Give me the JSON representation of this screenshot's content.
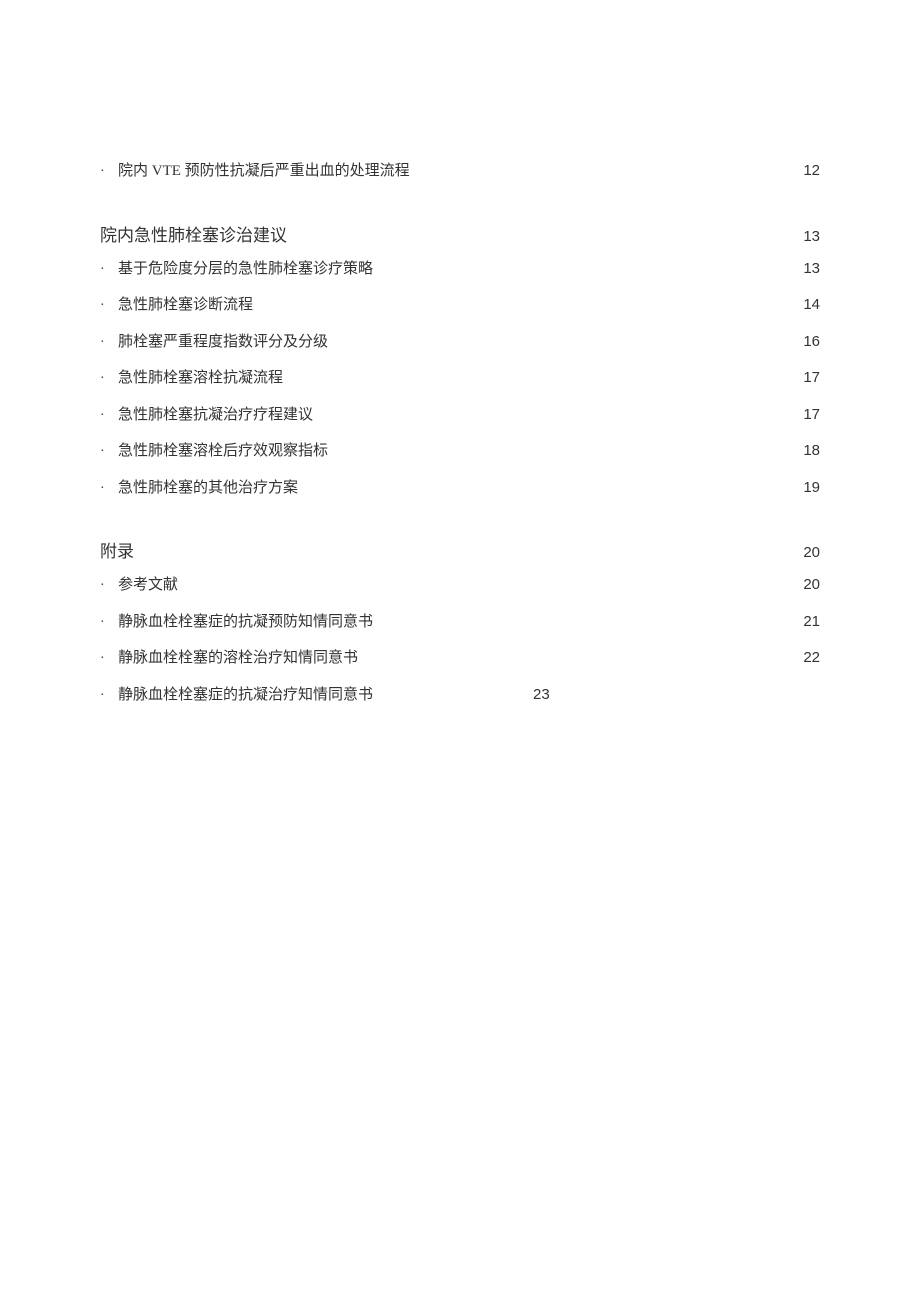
{
  "sections": [
    {
      "heading": null,
      "items": [
        {
          "title": "院内 VTE 预防性抗凝后严重出血的处理流程",
          "page": "12",
          "inline": false
        }
      ]
    },
    {
      "heading": {
        "title": "院内急性肺栓塞诊治建议",
        "page": "13"
      },
      "items": [
        {
          "title": "基于危险度分层的急性肺栓塞诊疗策略",
          "page": "13",
          "inline": false
        },
        {
          "title": "急性肺栓塞诊断流程",
          "page": "14",
          "inline": false
        },
        {
          "title": "肺栓塞严重程度指数评分及分级",
          "page": "16",
          "inline": false
        },
        {
          "title": "急性肺栓塞溶栓抗凝流程",
          "page": "17",
          "inline": false
        },
        {
          "title": "急性肺栓塞抗凝治疗疗程建议",
          "page": "17",
          "inline": false
        },
        {
          "title": "急性肺栓塞溶栓后疗效观察指标",
          "page": "18",
          "inline": false
        },
        {
          "title": "急性肺栓塞的其他治疗方案",
          "page": "19",
          "inline": false
        }
      ]
    },
    {
      "heading": {
        "title": "附录",
        "page": "20"
      },
      "items": [
        {
          "title": "参考文献",
          "page": "20",
          "inline": false
        },
        {
          "title": "静脉血栓栓塞症的抗凝预防知情同意书",
          "page": "21",
          "inline": false
        },
        {
          "title": "静脉血栓栓塞的溶栓治疗知情同意书",
          "page": "22",
          "inline": false
        },
        {
          "title": "静脉血栓栓塞症的抗凝治疗知情同意书",
          "page": "23",
          "inline": true
        }
      ]
    }
  ]
}
